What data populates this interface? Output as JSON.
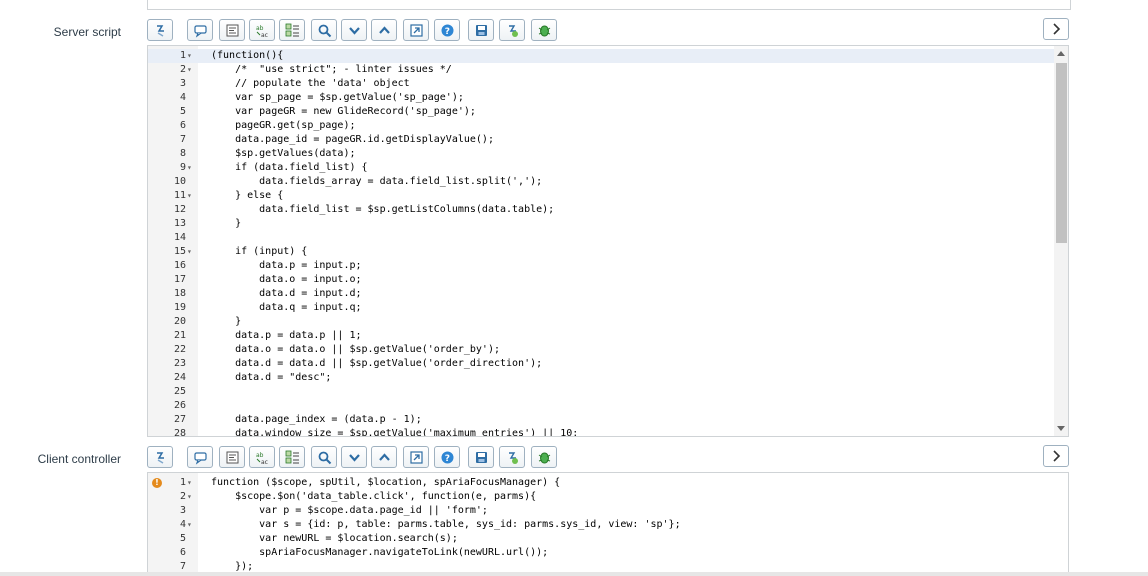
{
  "server_script": {
    "label": "Server script",
    "lines": [
      {
        "n": "1",
        "fold": "▾",
        "text": "(function(){"
      },
      {
        "n": "2",
        "fold": "▾",
        "text": "    /*  \"use strict\"; - linter issues */"
      },
      {
        "n": "3",
        "fold": "",
        "text": "    // populate the 'data' object"
      },
      {
        "n": "4",
        "fold": "",
        "text": "    var sp_page = $sp.getValue('sp_page');"
      },
      {
        "n": "5",
        "fold": "",
        "text": "    var pageGR = new GlideRecord('sp_page');"
      },
      {
        "n": "6",
        "fold": "",
        "text": "    pageGR.get(sp_page);"
      },
      {
        "n": "7",
        "fold": "",
        "text": "    data.page_id = pageGR.id.getDisplayValue();"
      },
      {
        "n": "8",
        "fold": "",
        "text": "    $sp.getValues(data);"
      },
      {
        "n": "9",
        "fold": "▾",
        "text": "    if (data.field_list) {"
      },
      {
        "n": "10",
        "fold": "",
        "text": "        data.fields_array = data.field_list.split(',');"
      },
      {
        "n": "11",
        "fold": "▾",
        "text": "    } else {"
      },
      {
        "n": "12",
        "fold": "",
        "text": "        data.field_list = $sp.getListColumns(data.table);"
      },
      {
        "n": "13",
        "fold": "",
        "text": "    }"
      },
      {
        "n": "14",
        "fold": "",
        "text": ""
      },
      {
        "n": "15",
        "fold": "▾",
        "text": "    if (input) {"
      },
      {
        "n": "16",
        "fold": "",
        "text": "        data.p = input.p;"
      },
      {
        "n": "17",
        "fold": "",
        "text": "        data.o = input.o;"
      },
      {
        "n": "18",
        "fold": "",
        "text": "        data.d = input.d;"
      },
      {
        "n": "19",
        "fold": "",
        "text": "        data.q = input.q;"
      },
      {
        "n": "20",
        "fold": "",
        "text": "    }"
      },
      {
        "n": "21",
        "fold": "",
        "text": "    data.p = data.p || 1;"
      },
      {
        "n": "22",
        "fold": "",
        "text": "    data.o = data.o || $sp.getValue('order_by');"
      },
      {
        "n": "23",
        "fold": "",
        "text": "    data.d = data.d || $sp.getValue('order_direction');"
      },
      {
        "n": "24",
        "fold": "",
        "text": "    data.d = \"desc\";"
      },
      {
        "n": "25",
        "fold": "",
        "text": ""
      },
      {
        "n": "26",
        "fold": "",
        "text": ""
      },
      {
        "n": "27",
        "fold": "",
        "text": "    data.page_index = (data.p - 1);"
      },
      {
        "n": "28",
        "fold": "",
        "text": "    data.window_size = $sp.getValue('maximum_entries') || 10;"
      }
    ]
  },
  "client_controller": {
    "label": "Client controller",
    "warning_icon": "!",
    "lines": [
      {
        "n": "1",
        "fold": "▾",
        "text": "function ($scope, spUtil, $location, spAriaFocusManager) {"
      },
      {
        "n": "2",
        "fold": "▾",
        "text": "    $scope.$on('data_table.click', function(e, parms){"
      },
      {
        "n": "3",
        "fold": "",
        "text": "        var p = $scope.data.page_id || 'form';"
      },
      {
        "n": "4",
        "fold": "▾",
        "text": "        var s = {id: p, table: parms.table, sys_id: parms.sys_id, view: 'sp'};"
      },
      {
        "n": "5",
        "fold": "",
        "text": "        var newURL = $location.search(s);"
      },
      {
        "n": "6",
        "fold": "",
        "text": "        spAriaFocusManager.navigateToLink(newURL.url());"
      },
      {
        "n": "7",
        "fold": "",
        "text": "    });"
      }
    ]
  },
  "toolbar_buttons": [
    {
      "name": "toggle-syntax-icon"
    },
    {
      "name": "comment-icon"
    },
    {
      "name": "format-code-icon"
    },
    {
      "name": "replace-icon"
    },
    {
      "name": "replace-all-icon"
    },
    {
      "name": "search-icon"
    },
    {
      "name": "find-next-icon"
    },
    {
      "name": "find-previous-icon"
    },
    {
      "name": "fullscreen-icon"
    },
    {
      "name": "help-icon"
    },
    {
      "name": "save-icon"
    },
    {
      "name": "script-debugger-icon"
    },
    {
      "name": "debug-icon"
    }
  ],
  "colors": {
    "accent": "#2e6da4",
    "warning": "#e48a1c",
    "gutter": "#f4f4f4"
  }
}
